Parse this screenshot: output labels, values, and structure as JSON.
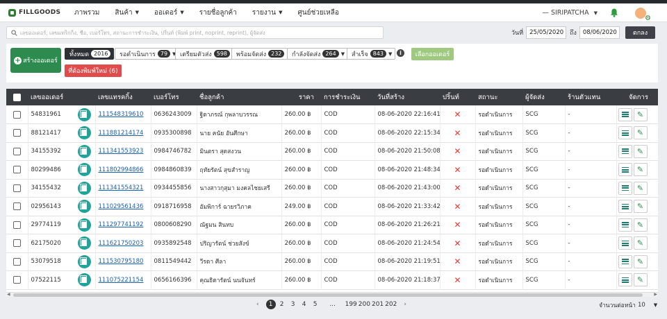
{
  "nav": {
    "logo": "FILLGOODS",
    "items": [
      {
        "label": "ภาพรวม",
        "caret": false
      },
      {
        "label": "สินค้า",
        "caret": true
      },
      {
        "label": "ออเดอร์",
        "caret": true
      },
      {
        "label": "รายชื่อลูกค้า",
        "caret": false
      },
      {
        "label": "รายงาน",
        "caret": true
      },
      {
        "label": "ศูนย์ช่วยเหลือ",
        "caret": false
      }
    ],
    "user": "SIRIPATCHA"
  },
  "search": {
    "placeholder": "เลขออเดอร์, เลขแทร็กกิ้ง, ชื่อ, เบอร์โทร, สถานะการชำระเงิน, ปริ้นท์ (พิมพ์ print, noprint, reprint), ผู้จัดส่ง",
    "date_label": "วันที่",
    "date_from": "25/05/2020",
    "to_label": "ถึง",
    "date_to": "08/06/2020",
    "button": "ตกลง"
  },
  "filters": {
    "create_button": "สร้างออเดอร์",
    "pills": [
      {
        "label": "ทั้งหมด",
        "count": "2016",
        "active": true,
        "dropdown": false
      },
      {
        "label": "รอดำเนินการ",
        "count": "79",
        "active": false,
        "dropdown": true
      },
      {
        "label": "เตรียมตัวส่ง",
        "count": "598",
        "active": false,
        "dropdown": false
      },
      {
        "label": "พร้อมจัดส่ง",
        "count": "232",
        "active": false,
        "dropdown": false
      },
      {
        "label": "กำลังจัดส่ง",
        "count": "264",
        "active": false,
        "dropdown": true
      },
      {
        "label": "สำเร็จ",
        "count": "843",
        "active": false,
        "dropdown": true
      }
    ],
    "info": "i",
    "select_orders": "เลือกออเดอร์",
    "reprint": "ที่ต้องพิมพ์ใหม่ (6)"
  },
  "table": {
    "headers": [
      "เลขออเดอร์",
      "เลขแทรคกิ้ง",
      "เบอร์โทร",
      "ชื่อลูกค้า",
      "ราคา",
      "การชำระเงิน",
      "วันที่สร้าง",
      "ปริ้นท์",
      "สถานะ",
      "ผู้จัดส่ง",
      "ร้านตัวแทน",
      "จัดการ"
    ],
    "rows": [
      {
        "order": "54831961",
        "tracking": "111548319610",
        "phone": "0636243009",
        "name": "ฐิดาภรณ์ กุพลาบวรรณ",
        "price": "260.00 ฿",
        "payment": "COD",
        "created": "08-06-2020 22:16:41",
        "printed": "✕",
        "status": "รอดำเนินการ",
        "courier": "SCG",
        "agent": "-"
      },
      {
        "order": "88121417",
        "tracking": "111881214174",
        "phone": "0935300898",
        "name": "นาย คนัย อันศึกษา",
        "price": "260.00 ฿",
        "payment": "COD",
        "created": "08-06-2020 22:15:34",
        "printed": "✕",
        "status": "รอดำเนินการ",
        "courier": "SCG",
        "agent": "-"
      },
      {
        "order": "34155392",
        "tracking": "111341553923",
        "phone": "0984746782",
        "name": "มินตรา สุดสงวน",
        "price": "260.00 ฿",
        "payment": "COD",
        "created": "08-06-2020 21:50:08",
        "printed": "✕",
        "status": "รอดำเนินการ",
        "courier": "SCG",
        "agent": "-"
      },
      {
        "order": "80299486",
        "tracking": "111802994866",
        "phone": "0984860839",
        "name": "ฤทัยรัตน์ สุขสำราญ",
        "price": "260.00 ฿",
        "payment": "COD",
        "created": "08-06-2020 21:48:34",
        "printed": "✕",
        "status": "รอดำเนินการ",
        "courier": "SCG",
        "agent": "-"
      },
      {
        "order": "34155432",
        "tracking": "111341554321",
        "phone": "0934455856",
        "name": "นางสาวกุสุมา มงคลไชยเสรี",
        "price": "260.00 ฿",
        "payment": "COD",
        "created": "08-06-2020 21:43:00",
        "printed": "✕",
        "status": "รอดำเนินการ",
        "courier": "SCG",
        "agent": "-"
      },
      {
        "order": "02956143",
        "tracking": "111029561436",
        "phone": "0918716958",
        "name": "อัมพิการ์ ฉายรวิภาค",
        "price": "249.00 ฿",
        "payment": "COD",
        "created": "08-06-2020 21:33:42",
        "printed": "✕",
        "status": "รอดำเนินการ",
        "courier": "SCG",
        "agent": "-"
      },
      {
        "order": "29774119",
        "tracking": "111297741192",
        "phone": "0800608290",
        "name": "ณัฐมน สินทบ",
        "price": "260.00 ฿",
        "payment": "COD",
        "created": "08-06-2020 21:26:21",
        "printed": "✕",
        "status": "รอดำเนินการ",
        "courier": "SCG",
        "agent": "-"
      },
      {
        "order": "62175020",
        "tracking": "111621750203",
        "phone": "0935892548",
        "name": "ปริญารัตน์ ช่วยสังข์",
        "price": "260.00 ฿",
        "payment": "COD",
        "created": "08-06-2020 21:24:54",
        "printed": "✕",
        "status": "รอดำเนินการ",
        "courier": "SCG",
        "agent": "-"
      },
      {
        "order": "53079518",
        "tracking": "111530795180",
        "phone": "0811549442",
        "name": "วีรดา ศีลา",
        "price": "260.00 ฿",
        "payment": "COD",
        "created": "08-06-2020 21:19:51",
        "printed": "✕",
        "status": "รอดำเนินการ",
        "courier": "SCG",
        "agent": "-"
      },
      {
        "order": "07522115",
        "tracking": "111075221154",
        "phone": "0656166396",
        "name": "คุณธิดารัตน์ นนจันทร์",
        "price": "260.00 ฿",
        "payment": "COD",
        "created": "08-06-2020 21:18:37",
        "printed": "✕",
        "status": "รอดำเนินการ",
        "courier": "SCG",
        "agent": "-"
      }
    ]
  },
  "pagination": {
    "pages": [
      "1",
      "2",
      "3",
      "4",
      "5",
      "...",
      "199",
      "200",
      "201",
      "202"
    ],
    "current": "1",
    "prev": "‹",
    "next": "›",
    "page_size_label": "จำนวนต่อหน้า",
    "page_size": "10"
  },
  "colors": {
    "create_button": "#2e8b4f",
    "copy_button": "#1fa39a",
    "reprint": "#e24b4b",
    "select_orders": "#9fc97e",
    "table_header": "#3a3d42",
    "printed_cross": "#e53935"
  }
}
